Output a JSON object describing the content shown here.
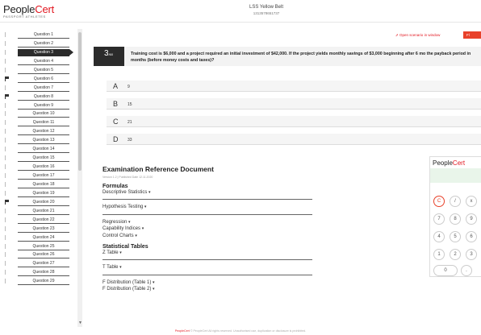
{
  "header": {
    "logo_main": "People",
    "logo_accent": "Cert",
    "logo_sub": "PASSPORT ATHLETES",
    "exam_title": "LSS Yellow Belt",
    "exam_code": "1313578651737"
  },
  "sidebar": {
    "questions": [
      {
        "label": "Question 1",
        "flagged": false,
        "active": false
      },
      {
        "label": "Question 2",
        "flagged": false,
        "active": false
      },
      {
        "label": "Question 3",
        "flagged": false,
        "active": true
      },
      {
        "label": "Question 4",
        "flagged": false,
        "active": false
      },
      {
        "label": "Question 5",
        "flagged": false,
        "active": false
      },
      {
        "label": "Question 6",
        "flagged": true,
        "active": false
      },
      {
        "label": "Question 7",
        "flagged": false,
        "active": false
      },
      {
        "label": "Question 8",
        "flagged": true,
        "active": false
      },
      {
        "label": "Question 9",
        "flagged": false,
        "active": false
      },
      {
        "label": "Question 10",
        "flagged": false,
        "active": false
      },
      {
        "label": "Question 11",
        "flagged": false,
        "active": false
      },
      {
        "label": "Question 12",
        "flagged": false,
        "active": false
      },
      {
        "label": "Question 13",
        "flagged": false,
        "active": false
      },
      {
        "label": "Question 14",
        "flagged": false,
        "active": false
      },
      {
        "label": "Question 15",
        "flagged": false,
        "active": false
      },
      {
        "label": "Question 16",
        "flagged": false,
        "active": false
      },
      {
        "label": "Question 17",
        "flagged": false,
        "active": false
      },
      {
        "label": "Question 18",
        "flagged": false,
        "active": false
      },
      {
        "label": "Question 19",
        "flagged": false,
        "active": false
      },
      {
        "label": "Question 20",
        "flagged": true,
        "active": false
      },
      {
        "label": "Question 21",
        "flagged": false,
        "active": false
      },
      {
        "label": "Question 22",
        "flagged": false,
        "active": false
      },
      {
        "label": "Question 23",
        "flagged": false,
        "active": false
      },
      {
        "label": "Question 24",
        "flagged": false,
        "active": false
      },
      {
        "label": "Question 25",
        "flagged": false,
        "active": false
      },
      {
        "label": "Question 26",
        "flagged": false,
        "active": false
      },
      {
        "label": "Question 27",
        "flagged": false,
        "active": false
      },
      {
        "label": "Question 28",
        "flagged": false,
        "active": false
      },
      {
        "label": "Question 29",
        "flagged": false,
        "active": false
      }
    ]
  },
  "toolbar": {
    "open_scenario": "Open scenario in window",
    "red_tab": "Fl"
  },
  "question": {
    "number": "3",
    "total": "/60",
    "text": "Training cost is $6,000 and a project required an initial investment of $42,000. If the project yields monthly savings of $3,000 beginning after 6 mo the payback period in months (before money costs and taxes)?"
  },
  "answers": [
    {
      "letter": "A",
      "value": "9"
    },
    {
      "letter": "B",
      "value": "15"
    },
    {
      "letter": "C",
      "value": "21"
    },
    {
      "letter": "D",
      "value": "33"
    }
  ],
  "reference": {
    "title": "Examination Reference Document",
    "version": "Version 1.2 | Published Date 12.11.2020",
    "formulas_heading": "Formulas",
    "formulas": [
      "Descriptive Statistics",
      "Hypothesis Testing",
      "Regression",
      "Capability Indices",
      "Control Charts"
    ],
    "tables_heading": "Statistical Tables",
    "tables": [
      "Z Table",
      "T Table",
      "F Distribution (Table 1)",
      "F Distribution (Table 2)"
    ]
  },
  "calculator": {
    "logo_main": "People",
    "logo_accent": "Cert",
    "keys": [
      {
        "label": "C",
        "kind": "clear"
      },
      {
        "label": "/",
        "kind": "op"
      },
      {
        "label": "x",
        "kind": "op"
      },
      {
        "label": "7",
        "kind": "num"
      },
      {
        "label": "8",
        "kind": "num"
      },
      {
        "label": "9",
        "kind": "num"
      },
      {
        "label": "4",
        "kind": "num"
      },
      {
        "label": "5",
        "kind": "num"
      },
      {
        "label": "6",
        "kind": "num"
      },
      {
        "label": "1",
        "kind": "num"
      },
      {
        "label": "2",
        "kind": "num"
      },
      {
        "label": "3",
        "kind": "num"
      },
      {
        "label": "0",
        "kind": "zero"
      },
      {
        "label": ".",
        "kind": "num"
      }
    ]
  },
  "footer": {
    "text": "© PeopleCert All rights reserved. Unauthorised use, duplication or disclosure is prohibited.",
    "link": "PeopleCert"
  }
}
